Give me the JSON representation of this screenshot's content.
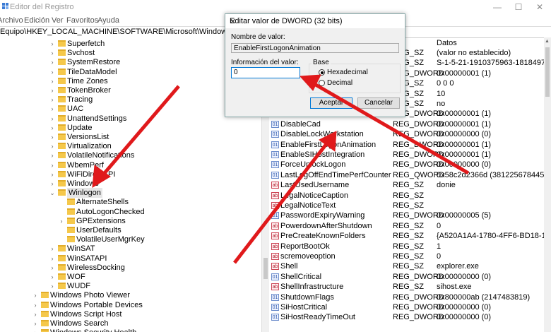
{
  "window": {
    "title": "Editor del Registro",
    "min": "—",
    "max": "☐",
    "close": "✕"
  },
  "menu": [
    "Archivo",
    "Edición",
    "Ver",
    "Favoritos",
    "Ayuda"
  ],
  "address": "Equipo\\HKEY_LOCAL_MACHINE\\SOFTWARE\\Microsoft\\Windows NT\\CurrentVersion",
  "tree": [
    {
      "label": "Superfetch"
    },
    {
      "label": "Svchost"
    },
    {
      "label": "SystemRestore"
    },
    {
      "label": "TileDataModel"
    },
    {
      "label": "Time Zones"
    },
    {
      "label": "TokenBroker"
    },
    {
      "label": "Tracing"
    },
    {
      "label": "UAC"
    },
    {
      "label": "UnattendSettings"
    },
    {
      "label": "Update"
    },
    {
      "label": "VersionsList"
    },
    {
      "label": "Virtualization"
    },
    {
      "label": "VolatileNotifications"
    },
    {
      "label": "WbemPerf"
    },
    {
      "label": "WiFiDirectAPI"
    },
    {
      "label": "Windows"
    },
    {
      "label": "Winlogon"
    },
    {
      "label": "AlternateShells"
    },
    {
      "label": "AutoLogonChecked"
    },
    {
      "label": "GPExtensions"
    },
    {
      "label": "UserDefaults"
    },
    {
      "label": "VolatileUserMgrKey"
    },
    {
      "label": "WinSAT"
    },
    {
      "label": "WinSATAPI"
    },
    {
      "label": "WirelessDocking"
    },
    {
      "label": "WOF"
    },
    {
      "label": "WUDF"
    },
    {
      "label": "Windows Photo Viewer"
    },
    {
      "label": "Windows Portable Devices"
    },
    {
      "label": "Windows Script Host"
    },
    {
      "label": "Windows Search"
    },
    {
      "label": "Windows Security Health"
    }
  ],
  "list": {
    "header_data": "Datos",
    "rows": [
      {
        "name": "",
        "type": "REG_SZ",
        "data": "(valor no establecido)",
        "icon": "sz"
      },
      {
        "name": "",
        "type": "REG_SZ",
        "data": "S-1-5-21-1910375963-1818497",
        "icon": "sz"
      },
      {
        "name": "",
        "type": "REG_DWORD",
        "data": "0x00000001 (1)",
        "icon": "bin"
      },
      {
        "name": "",
        "type": "REG_SZ",
        "data": "0 0 0",
        "icon": "sz"
      },
      {
        "name": "",
        "type": "REG_SZ",
        "data": "10",
        "icon": "sz"
      },
      {
        "name": "",
        "type": "REG_SZ",
        "data": "no",
        "icon": "sz"
      },
      {
        "name": "DisableBackButton",
        "type": "REG_DWORD",
        "data": "0x00000001 (1)",
        "icon": "bin"
      },
      {
        "name": "DisableCad",
        "type": "REG_DWORD",
        "data": "0x00000001 (1)",
        "icon": "bin"
      },
      {
        "name": "DisableLockWorkstation",
        "type": "REG_DWORD",
        "data": "0x00000000 (0)",
        "icon": "bin"
      },
      {
        "name": "EnableFirstLogonAnimation",
        "type": "REG_DWORD",
        "data": "0x00000001 (1)",
        "icon": "bin"
      },
      {
        "name": "EnableSIHostIntegration",
        "type": "REG_DWORD",
        "data": "0x00000001 (1)",
        "icon": "bin"
      },
      {
        "name": "ForceUnlockLogon",
        "type": "REG_DWORD",
        "data": "0x00000000 (0)",
        "icon": "bin"
      },
      {
        "name": "LastLogOffEndTimePerfCounter",
        "type": "REG_QWORD",
        "data": "0x58c2d2366d (381225678445)",
        "icon": "bin"
      },
      {
        "name": "LastUsedUsername",
        "type": "REG_SZ",
        "data": "donie",
        "icon": "sz"
      },
      {
        "name": "LegalNoticeCaption",
        "type": "REG_SZ",
        "data": "",
        "icon": "sz"
      },
      {
        "name": "LegalNoticeText",
        "type": "REG_SZ",
        "data": "",
        "icon": "sz"
      },
      {
        "name": "PasswordExpiryWarning",
        "type": "REG_DWORD",
        "data": "0x00000005 (5)",
        "icon": "bin"
      },
      {
        "name": "PowerdownAfterShutdown",
        "type": "REG_SZ",
        "data": "0",
        "icon": "sz"
      },
      {
        "name": "PreCreateKnownFolders",
        "type": "REG_SZ",
        "data": "{A520A1A4-1780-4FF6-BD18-16",
        "icon": "sz"
      },
      {
        "name": "ReportBootOk",
        "type": "REG_SZ",
        "data": "1",
        "icon": "sz"
      },
      {
        "name": "scremoveoption",
        "type": "REG_SZ",
        "data": "0",
        "icon": "sz"
      },
      {
        "name": "Shell",
        "type": "REG_SZ",
        "data": "explorer.exe",
        "icon": "sz"
      },
      {
        "name": "ShellCritical",
        "type": "REG_DWORD",
        "data": "0x00000000 (0)",
        "icon": "bin"
      },
      {
        "name": "ShellInfrastructure",
        "type": "REG_SZ",
        "data": "sihost.exe",
        "icon": "sz"
      },
      {
        "name": "ShutdownFlags",
        "type": "REG_DWORD",
        "data": "0x800000ab (2147483819)",
        "icon": "bin"
      },
      {
        "name": "SiHostCritical",
        "type": "REG_DWORD",
        "data": "0x00000000 (0)",
        "icon": "bin"
      },
      {
        "name": "SiHostReadyTimeOut",
        "type": "REG_DWORD",
        "data": "0x00000000 (0)",
        "icon": "bin"
      }
    ]
  },
  "dialog": {
    "title": "Editar valor de DWORD (32 bits)",
    "close": "✕",
    "name_label": "Nombre de valor:",
    "name_value": "EnableFirstLogonAnimation",
    "data_label": "Información del valor:",
    "data_value": "0",
    "base_label": "Base",
    "hex_label": "Hexadecimal",
    "dec_label": "Decimal",
    "ok_label": "Aceptar",
    "cancel_label": "Cancelar"
  },
  "colors": {
    "arrow": "#e0191b",
    "folder": "#f5c84b",
    "accent": "#0078d7"
  }
}
